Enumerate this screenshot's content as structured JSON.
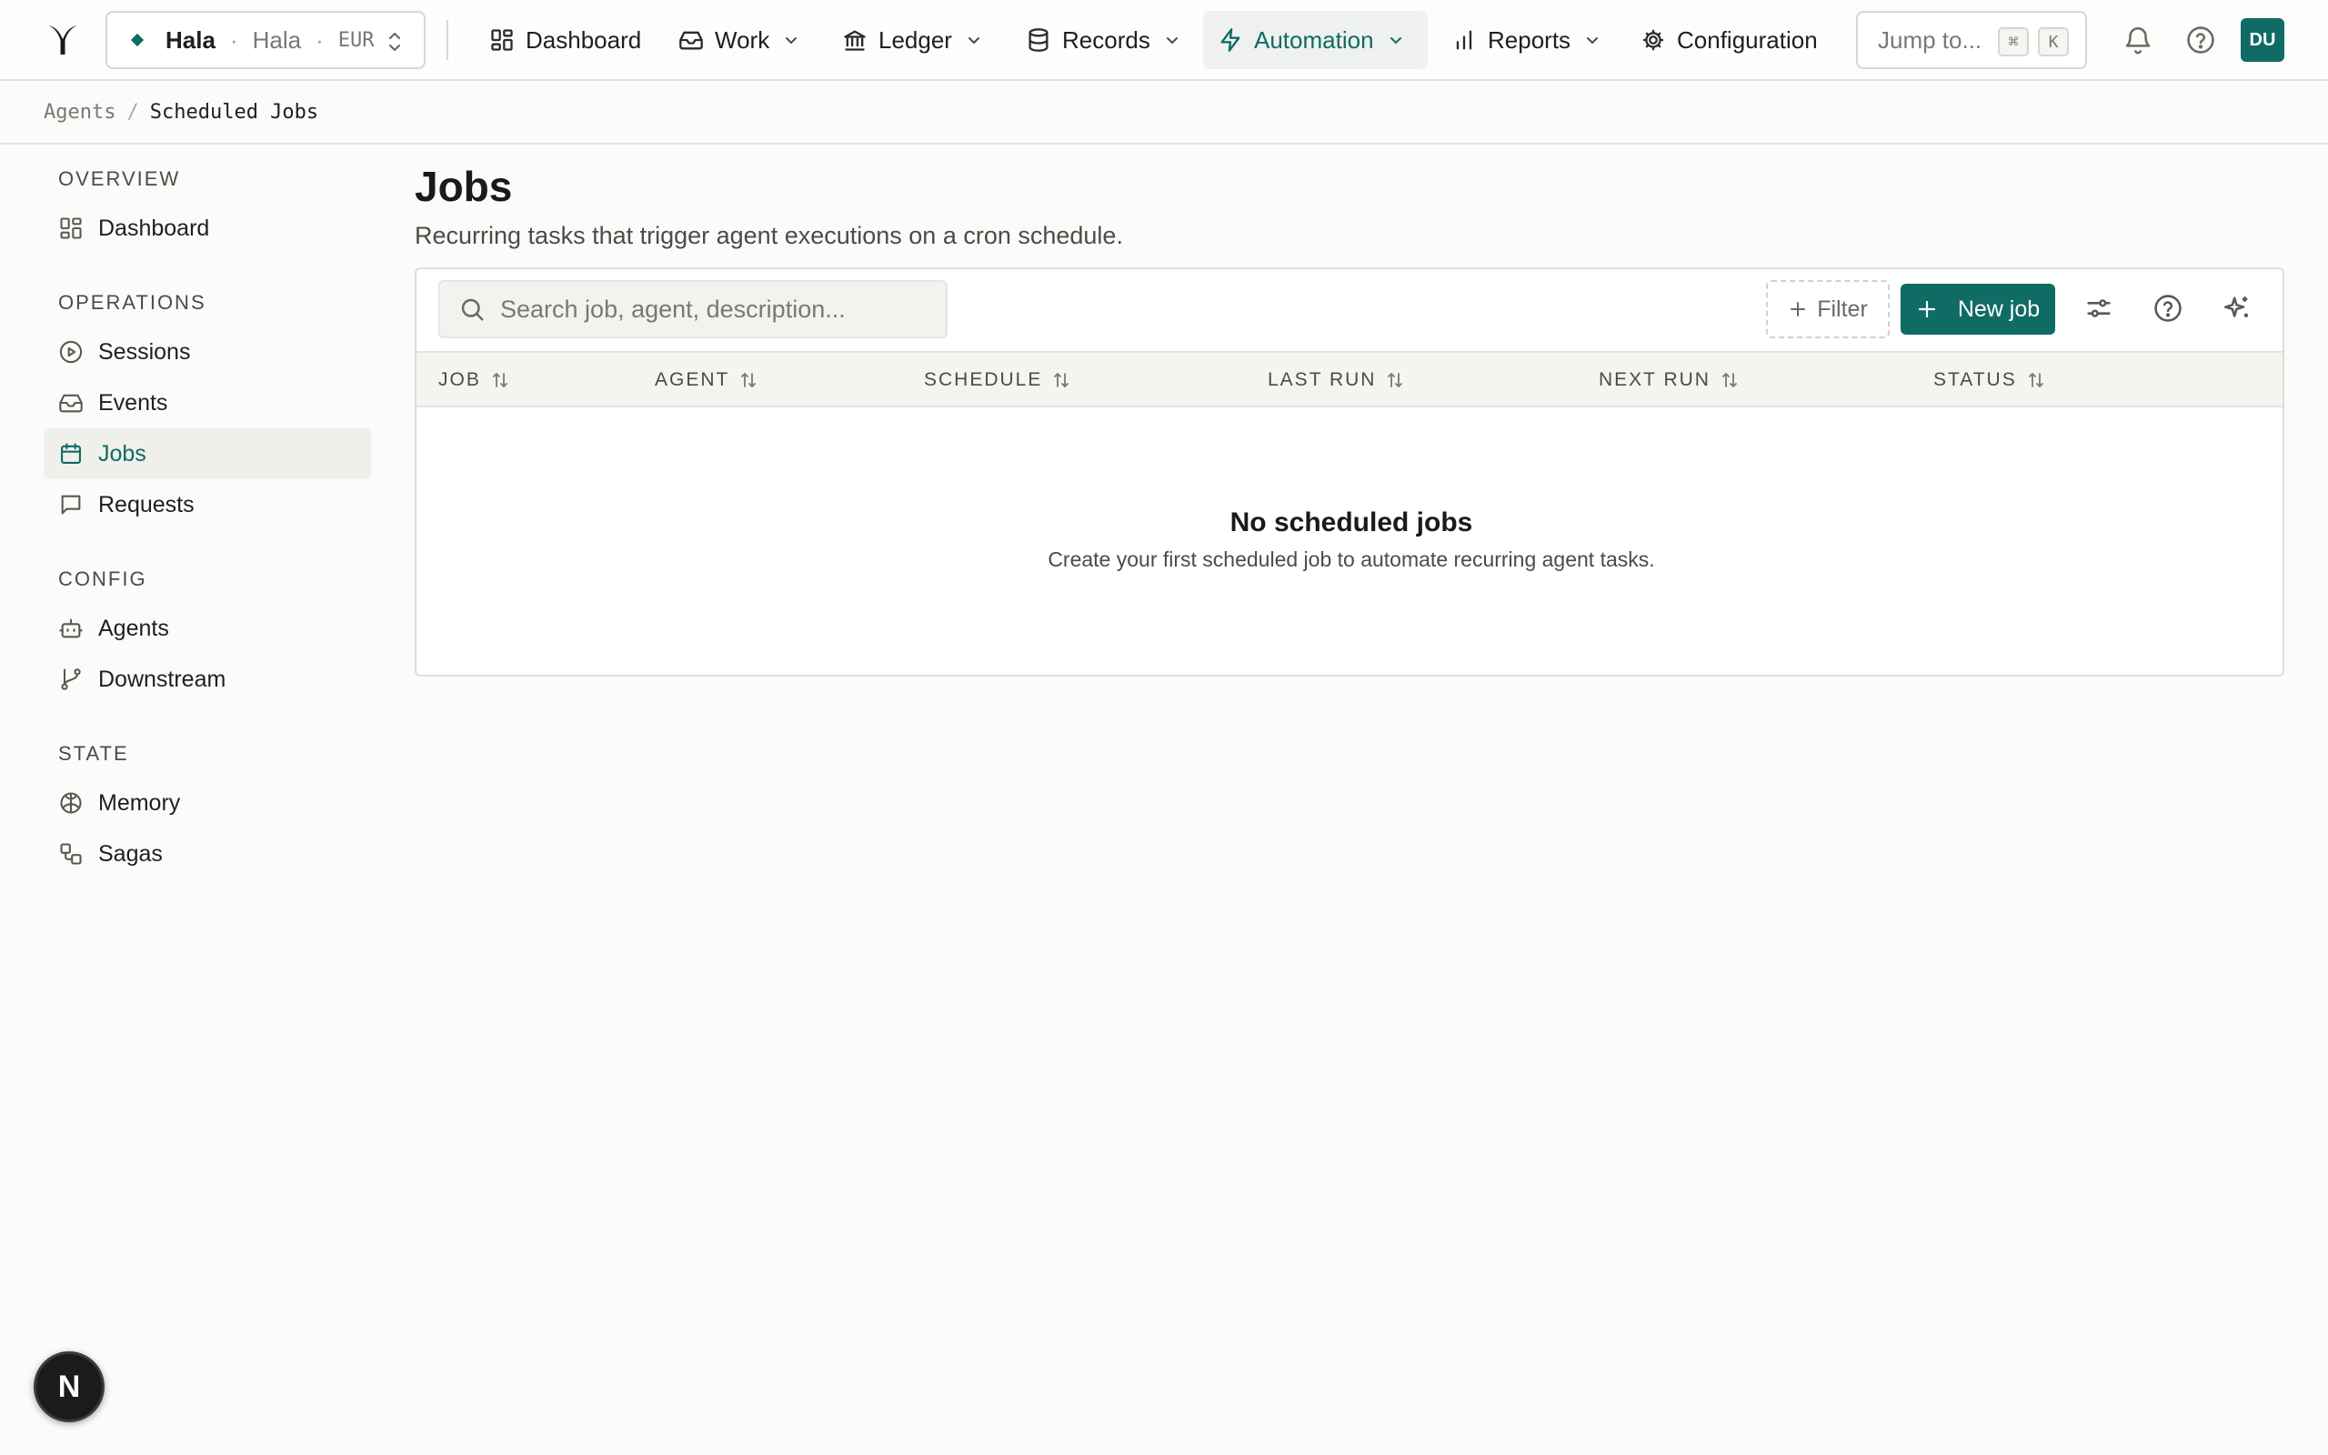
{
  "topbar": {
    "org": {
      "name": "Hala",
      "entity": "Hala",
      "currency": "EUR",
      "separator": "·"
    },
    "nav": [
      {
        "label": "Dashboard",
        "icon": "grid-icon",
        "has_dropdown": false
      },
      {
        "label": "Work",
        "icon": "inbox-icon",
        "has_dropdown": true
      },
      {
        "label": "Ledger",
        "icon": "bank-icon",
        "has_dropdown": true
      },
      {
        "label": "Records",
        "icon": "database-icon",
        "has_dropdown": true
      },
      {
        "label": "Automation",
        "icon": "zap-icon",
        "has_dropdown": true,
        "active": true
      },
      {
        "label": "Reports",
        "icon": "bar-chart-icon",
        "has_dropdown": true
      },
      {
        "label": "Configuration",
        "icon": "gear-icon",
        "has_dropdown": false
      }
    ],
    "jump": {
      "placeholder": "Jump to...",
      "key1": "⌘",
      "key2": "K"
    },
    "avatar_initials": "DU"
  },
  "breadcrumb": {
    "parent": "Agents",
    "separator": "/",
    "current": "Scheduled Jobs"
  },
  "sidebar": {
    "sections": [
      {
        "title": "OVERVIEW",
        "items": [
          {
            "label": "Dashboard",
            "icon": "grid-icon"
          }
        ]
      },
      {
        "title": "OPERATIONS",
        "items": [
          {
            "label": "Sessions",
            "icon": "play-circle-icon"
          },
          {
            "label": "Events",
            "icon": "inbox-icon"
          },
          {
            "label": "Jobs",
            "icon": "calendar-icon",
            "active": true
          },
          {
            "label": "Requests",
            "icon": "message-square-icon"
          }
        ]
      },
      {
        "title": "CONFIG",
        "items": [
          {
            "label": "Agents",
            "icon": "bot-icon"
          },
          {
            "label": "Downstream",
            "icon": "git-branch-icon"
          }
        ]
      },
      {
        "title": "STATE",
        "items": [
          {
            "label": "Memory",
            "icon": "brain-icon"
          },
          {
            "label": "Sagas",
            "icon": "workflow-icon"
          }
        ]
      }
    ]
  },
  "main": {
    "title": "Jobs",
    "subtitle": "Recurring tasks that trigger agent executions on a cron schedule.",
    "search_placeholder": "Search job, agent, description...",
    "filter_label": "Filter",
    "new_label": "New job",
    "columns": [
      "JOB",
      "AGENT",
      "SCHEDULE",
      "LAST RUN",
      "NEXT RUN",
      "STATUS"
    ],
    "rows": [],
    "empty": {
      "title": "No scheduled jobs",
      "message": "Create your first scheduled job to automate recurring agent tasks."
    }
  },
  "colors": {
    "accent": "#0f6b63",
    "background": "#fcfbf9",
    "border": "#e0ddd8"
  },
  "dev_badge": "N"
}
